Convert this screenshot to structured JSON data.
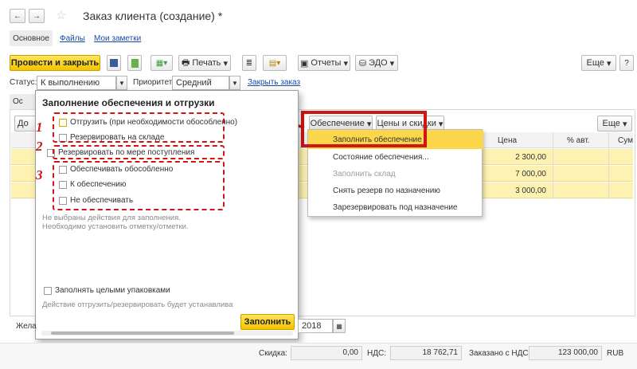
{
  "window": {
    "title": "Заказ клиента (создание) *"
  },
  "nav": {
    "back": "←",
    "forward": "→"
  },
  "tabs": [
    "Основное",
    "Файлы",
    "Мои заметки"
  ],
  "toolbar": {
    "post_close": "Провести и закрыть",
    "print": "Печать",
    "reports": "Отчеты",
    "edo": "ЭДО",
    "more": "Еще"
  },
  "status": {
    "status_label": "Статус:",
    "status_value": "К выполнению",
    "priority_label": "Приоритет:",
    "priority_value": "Средний",
    "close_order_link": "Закрыть заказ"
  },
  "left_fragments": {
    "tab_partial": "Ос",
    "button_partial": "До"
  },
  "products_toolbar": {
    "provision_button": "Обеспечение",
    "prices_button": "Цены и скидки",
    "more": "Еще"
  },
  "provision_menu": {
    "items": [
      "Заполнить обеспечение",
      "Состояние обеспечения...",
      "Заполнить склад",
      "Снять резерв по назначению",
      "Зарезервировать под назначение"
    ]
  },
  "table": {
    "headers": [
      "Цена",
      "% авт.",
      "Сум"
    ],
    "prices": [
      "2 300,00",
      "7 000,00",
      "3 000,00"
    ]
  },
  "dialog": {
    "title": "Заполнение обеспечения и отгрузки",
    "group1": [
      "Отгрузить (при необходимости обособленно)",
      "Резервировать на складе"
    ],
    "group2": [
      "Резервировать по мере поступления"
    ],
    "group3": [
      "Обеспечивать обособленно",
      "К обеспечению",
      "Не обеспечивать"
    ],
    "hint1": "Не выбраны действия для заполнения.",
    "hint2": "Необходимо установить отметку/отметки.",
    "whole_packages": "Заполнять целыми упаковками",
    "note": "Действие отгрузить/резервировать будет устанавливаться",
    "fill_button": "Заполнить"
  },
  "annotations": {
    "n1": "1",
    "n2": "2",
    "n3": "3"
  },
  "bottom": {
    "desired_label": "Жела",
    "date_value": "2018"
  },
  "footer": {
    "discount_label": "Скидка:",
    "discount_value": "0,00",
    "vat_label": "НДС:",
    "vat_value": "18 762,71",
    "ordered_label": "Заказано с НДС:",
    "ordered_value": "123 000,00",
    "currency": "RUB"
  },
  "colors": {
    "accent_yellow": "#f5c400",
    "highlight_row": "#fdf2b1",
    "annotation_red": "#d01515",
    "link_blue": "#1a4aa7"
  }
}
